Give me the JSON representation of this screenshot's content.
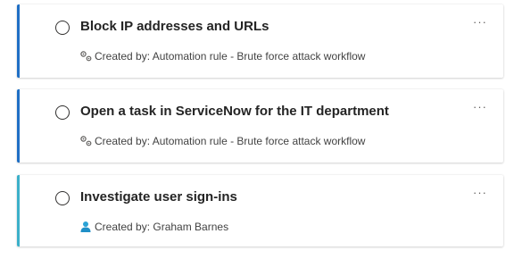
{
  "tasks": [
    {
      "title": "Block IP addresses and URLs",
      "created_by": "Created by: Automation rule - Brute force attack workflow",
      "creator_icon": "automation-icon",
      "accent": "#1f6fc5",
      "completed": false
    },
    {
      "title": "Open a task in ServiceNow for the IT department",
      "created_by": "Created by: Automation rule - Brute force attack workflow",
      "creator_icon": "automation-icon",
      "accent": "#1f6fc5",
      "completed": false
    },
    {
      "title": "Investigate user sign-ins",
      "created_by": "Created by: Graham Barnes",
      "creator_icon": "user-icon",
      "accent": "#3bb0c9",
      "completed": false
    }
  ],
  "more_label": "···"
}
